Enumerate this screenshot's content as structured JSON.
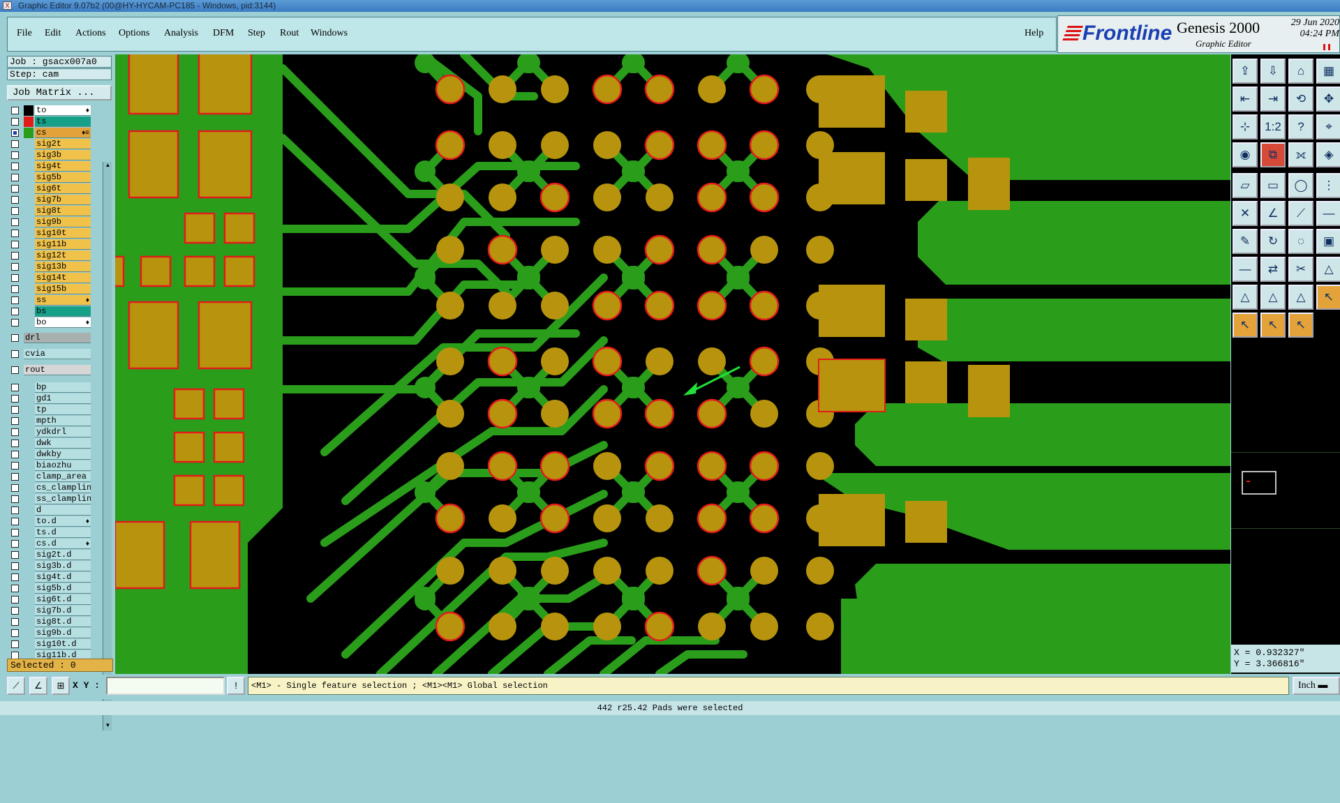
{
  "window": {
    "title": "Graphic Editor 9.07b2 (00@HY-HYCAM-PC185 - Windows, pid:3144)"
  },
  "menu": {
    "items": [
      "File",
      "Edit",
      "Actions",
      "Options",
      "Analysis",
      "DFM",
      "Step",
      "Rout",
      "Windows"
    ],
    "help": "Help"
  },
  "logo": {
    "brand": "Frontline",
    "product": "Genesis 2000",
    "subtitle": "Graphic Editor",
    "date": "29 Jun 2020",
    "time": "04:24 PM"
  },
  "job": {
    "job_label": "Job : gsacx007a0",
    "step_label": "Step: cam",
    "matrix_button": "Job Matrix ..."
  },
  "layers": [
    {
      "name": "to",
      "color": "#ffffff",
      "swatch": "#000000",
      "flag": "♦"
    },
    {
      "name": "ts",
      "color": "#17a088",
      "swatch": "#e21b1b",
      "flag": ""
    },
    {
      "name": "cs",
      "color": "#e3a23a",
      "swatch": "#2a9d1b",
      "flag": "♦≡",
      "checked": true
    },
    {
      "name": "sig2t",
      "color": "#f0c24a",
      "swatch": "",
      "flag": ""
    },
    {
      "name": "sig3b",
      "color": "#f0c24a",
      "swatch": "",
      "flag": ""
    },
    {
      "name": "sig4t",
      "color": "#f0c24a",
      "swatch": "",
      "flag": ""
    },
    {
      "name": "sig5b",
      "color": "#f0c24a",
      "swatch": "",
      "flag": ""
    },
    {
      "name": "sig6t",
      "color": "#f0c24a",
      "swatch": "",
      "flag": ""
    },
    {
      "name": "sig7b",
      "color": "#f0c24a",
      "swatch": "",
      "flag": ""
    },
    {
      "name": "sig8t",
      "color": "#f0c24a",
      "swatch": "",
      "flag": ""
    },
    {
      "name": "sig9b",
      "color": "#f0c24a",
      "swatch": "",
      "flag": ""
    },
    {
      "name": "sig10t",
      "color": "#f0c24a",
      "swatch": "",
      "flag": ""
    },
    {
      "name": "sig11b",
      "color": "#f0c24a",
      "swatch": "",
      "flag": ""
    },
    {
      "name": "sig12t",
      "color": "#f0c24a",
      "swatch": "",
      "flag": ""
    },
    {
      "name": "sig13b",
      "color": "#f0c24a",
      "swatch": "",
      "flag": ""
    },
    {
      "name": "sig14t",
      "color": "#f0c24a",
      "swatch": "",
      "flag": ""
    },
    {
      "name": "sig15b",
      "color": "#f0c24a",
      "swatch": "",
      "flag": ""
    },
    {
      "name": "ss",
      "color": "#f0c24a",
      "swatch": "",
      "flag": "♦"
    },
    {
      "name": "bs",
      "color": "#17a088",
      "swatch": "",
      "flag": ""
    },
    {
      "name": "bo",
      "color": "#ffffff",
      "swatch": "",
      "flag": "♦"
    },
    {
      "name": "drl",
      "color": "#a8b0b0",
      "swatch": "",
      "flag": "",
      "wide": true
    },
    {
      "name": "cvia",
      "color": "#b6dfe2",
      "swatch": "",
      "flag": "",
      "wide": true
    },
    {
      "name": "rout",
      "color": "#d6d6d6",
      "swatch": "",
      "flag": "",
      "wide": true
    },
    {
      "name": "bp",
      "color": "#b6dfe2",
      "swatch": "",
      "flag": ""
    },
    {
      "name": "gd1",
      "color": "#b6dfe2",
      "swatch": "",
      "flag": ""
    },
    {
      "name": "tp",
      "color": "#b6dfe2",
      "swatch": "",
      "flag": ""
    },
    {
      "name": "mpth",
      "color": "#b6dfe2",
      "swatch": "",
      "flag": ""
    },
    {
      "name": "ydkdrl",
      "color": "#b6dfe2",
      "swatch": "",
      "flag": ""
    },
    {
      "name": "dwk",
      "color": "#b6dfe2",
      "swatch": "",
      "flag": ""
    },
    {
      "name": "dwkby",
      "color": "#b6dfe2",
      "swatch": "",
      "flag": ""
    },
    {
      "name": "biaozhu",
      "color": "#b6dfe2",
      "swatch": "",
      "flag": ""
    },
    {
      "name": "clamp_area",
      "color": "#b6dfe2",
      "swatch": "",
      "flag": ""
    },
    {
      "name": "cs_clampline",
      "color": "#b6dfe2",
      "swatch": "",
      "flag": ""
    },
    {
      "name": "ss_clampline",
      "color": "#b6dfe2",
      "swatch": "",
      "flag": ""
    },
    {
      "name": "d",
      "color": "#b6dfe2",
      "swatch": "",
      "flag": ""
    },
    {
      "name": "to.d",
      "color": "#b6dfe2",
      "swatch": "",
      "flag": "♦"
    },
    {
      "name": "ts.d",
      "color": "#b6dfe2",
      "swatch": "",
      "flag": ""
    },
    {
      "name": "cs.d",
      "color": "#b6dfe2",
      "swatch": "",
      "flag": "♦"
    },
    {
      "name": "sig2t.d",
      "color": "#b6dfe2",
      "swatch": "",
      "flag": ""
    },
    {
      "name": "sig3b.d",
      "color": "#b6dfe2",
      "swatch": "",
      "flag": ""
    },
    {
      "name": "sig4t.d",
      "color": "#b6dfe2",
      "swatch": "",
      "flag": ""
    },
    {
      "name": "sig5b.d",
      "color": "#b6dfe2",
      "swatch": "",
      "flag": ""
    },
    {
      "name": "sig6t.d",
      "color": "#b6dfe2",
      "swatch": "",
      "flag": ""
    },
    {
      "name": "sig7b.d",
      "color": "#b6dfe2",
      "swatch": "",
      "flag": ""
    },
    {
      "name": "sig8t.d",
      "color": "#b6dfe2",
      "swatch": "",
      "flag": ""
    },
    {
      "name": "sig9b.d",
      "color": "#b6dfe2",
      "swatch": "",
      "flag": ""
    },
    {
      "name": "sig10t.d",
      "color": "#b6dfe2",
      "swatch": "",
      "flag": ""
    },
    {
      "name": "sig11b.d",
      "color": "#b6dfe2",
      "swatch": "",
      "flag": ""
    }
  ],
  "selected": "Selected : 0",
  "coords": {
    "x": "X = 0.932327\"",
    "y": "Y = 3.366816\""
  },
  "bottom": {
    "xy_label": "X Y :",
    "xy_value": "",
    "message": "<M1> - Single feature selection ; <M1><M1> Global selection",
    "units": "Inch"
  },
  "status": "442 r25.42 Pads were selected",
  "colors": {
    "copper": "#2a9d1b",
    "pad": "#b8940e",
    "selected_outline": "#e21b1b",
    "background": "#000000",
    "panel": "#9ccfd3"
  },
  "toolbar_icons": [
    "zoom-home-icon",
    "zoom-fit-icon",
    "home-icon",
    "panel-icon",
    "zoom-in-icon",
    "zoom-out-icon",
    "zoom-back-icon",
    "pan-icon",
    "measure-icon",
    "ratio-icon",
    "question-icon",
    "snapshot-icon",
    "camera-icon",
    "net-icon",
    "layer-icon",
    "feature-icon",
    "polygon-icon",
    "ruler-icon",
    "circle-icon",
    "connect-icon",
    "cross-icon",
    "angle-icon",
    "link-icon",
    "line-icon",
    "draw-icon",
    "rotate-icon",
    "arc-icon",
    "pad-icon",
    "dash-icon",
    "mirror-icon",
    "cut-icon",
    "triangle-icon",
    "triangle-move-icon",
    "triangle-edit-icon",
    "triangle-pan-icon",
    "select-icon",
    "select-pick-icon",
    "select-rotate-icon",
    "select-move-icon"
  ]
}
